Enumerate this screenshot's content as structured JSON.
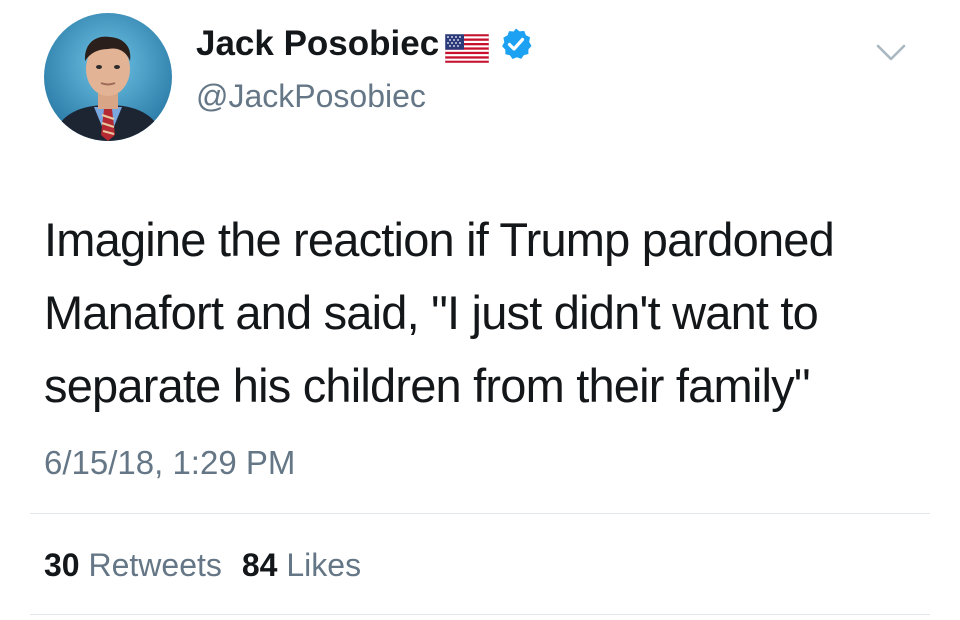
{
  "tweet": {
    "author": {
      "display_name": "Jack Posobiec",
      "handle": "@JackPosobiec",
      "flag_icon": "us-flag-icon",
      "verified_icon": "verified-badge-icon",
      "verified_color": "#1da1f2"
    },
    "text_lines": [
      "Imagine the reaction if Trump pardoned",
      "Manafort and said, \"I just didn't want to",
      "separate his children from their family\""
    ],
    "timestamp": "6/15/18, 1:29 PM",
    "stats": {
      "retweets_count": "30",
      "retweets_label": "Retweets",
      "likes_count": "84",
      "likes_label": "Likes"
    },
    "menu_icon": "chevron-down-icon"
  }
}
